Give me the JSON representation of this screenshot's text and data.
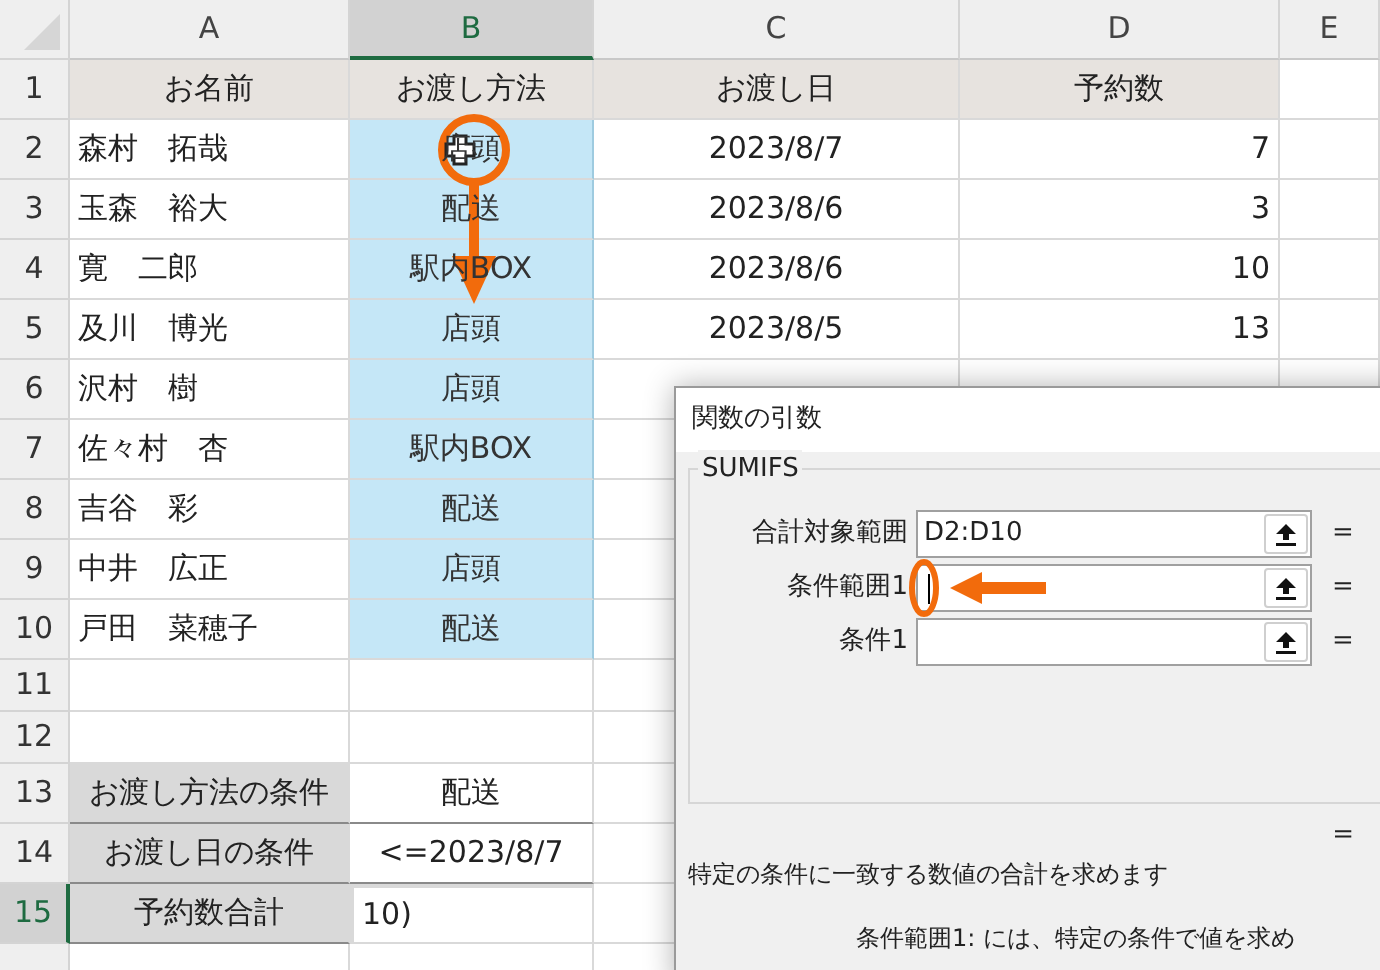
{
  "columns": [
    {
      "label": "A",
      "selected": false
    },
    {
      "label": "B",
      "selected": true
    },
    {
      "label": "C",
      "selected": false
    },
    {
      "label": "D",
      "selected": false
    },
    {
      "label": "E",
      "selected": false
    }
  ],
  "rows": [
    {
      "number": "1",
      "selected": false,
      "kind": "header",
      "cells": [
        "お名前",
        "お渡し方法",
        "お渡し日",
        "予約数"
      ]
    },
    {
      "number": "2",
      "selected": false,
      "kind": "data",
      "cells": [
        "森村　拓哉",
        "店頭",
        "2023/8/7",
        "7"
      ]
    },
    {
      "number": "3",
      "selected": false,
      "kind": "data",
      "cells": [
        "玉森　裕大",
        "配送",
        "2023/8/6",
        "3"
      ]
    },
    {
      "number": "4",
      "selected": false,
      "kind": "data",
      "cells": [
        "寛　二郎",
        "駅内BOX",
        "2023/8/6",
        "10"
      ]
    },
    {
      "number": "5",
      "selected": false,
      "kind": "data",
      "cells": [
        "及川　博光",
        "店頭",
        "2023/8/5",
        "13"
      ]
    },
    {
      "number": "6",
      "selected": false,
      "kind": "data",
      "cells": [
        "沢村　樹",
        "店頭"
      ]
    },
    {
      "number": "7",
      "selected": false,
      "kind": "data",
      "cells": [
        "佐々村　杏",
        "駅内BOX"
      ]
    },
    {
      "number": "8",
      "selected": false,
      "kind": "data",
      "cells": [
        "吉谷　彩",
        "配送"
      ]
    },
    {
      "number": "9",
      "selected": false,
      "kind": "data",
      "cells": [
        "中井　広正",
        "店頭"
      ]
    },
    {
      "number": "10",
      "selected": false,
      "kind": "data",
      "cells": [
        "戸田　菜穂子",
        "配送"
      ]
    },
    {
      "number": "11",
      "selected": false,
      "kind": "blank",
      "cells": []
    },
    {
      "number": "12",
      "selected": false,
      "kind": "blank",
      "cells": []
    },
    {
      "number": "13",
      "selected": false,
      "kind": "criteria",
      "cells": [
        "お渡し方法の条件",
        "配送"
      ]
    },
    {
      "number": "14",
      "selected": false,
      "kind": "criteria",
      "cells": [
        "お渡し日の条件",
        "<=2023/8/7"
      ]
    },
    {
      "number": "15",
      "selected": true,
      "kind": "criteria",
      "cells": [
        "予約数合計",
        "10)"
      ]
    },
    {
      "number": "",
      "selected": false,
      "kind": "blank",
      "cells": []
    }
  ],
  "dialog": {
    "title": "関数の引数",
    "function": "SUMIFS",
    "arguments": [
      {
        "label": "合計対象範囲",
        "value": "D2:D10",
        "equals": "="
      },
      {
        "label": "条件範囲1",
        "focused": true,
        "equals": "="
      },
      {
        "label": "条件1",
        "focused": false,
        "equals": "="
      }
    ],
    "result_equals": "=",
    "description": "特定の条件に一致する数値の合計を求めます",
    "help": "条件範囲1:  には、特定の条件で値を求め"
  }
}
